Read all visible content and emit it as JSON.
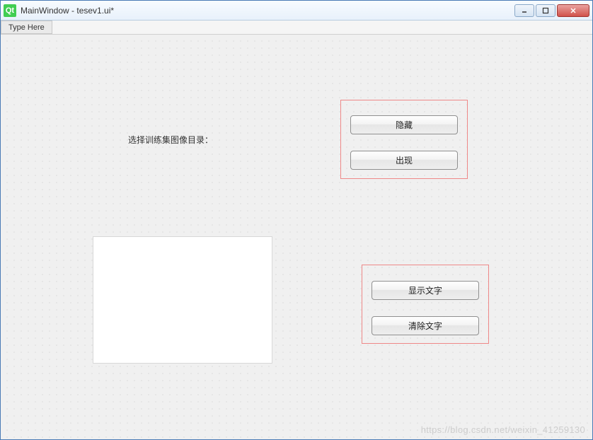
{
  "window": {
    "icon_text": "Qt",
    "title": "MainWindow - tesev1.ui*"
  },
  "window_controls": {
    "minimize": "minimize",
    "maximize": "maximize",
    "close": "close"
  },
  "menubar": {
    "type_here": "Type Here"
  },
  "labels": {
    "select_dir": "选择训练集图像目录："
  },
  "buttons": {
    "hide": "隐藏",
    "appear": "出现",
    "show_text": "显示文字",
    "clear_text": "清除文字"
  },
  "watermark": "https://blog.csdn.net/weixin_41259130"
}
